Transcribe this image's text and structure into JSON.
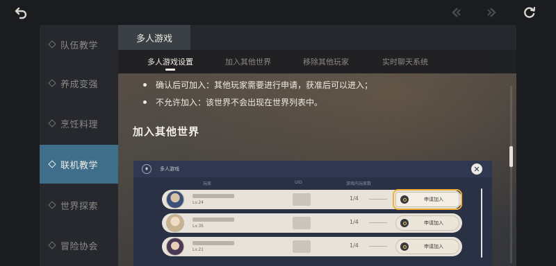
{
  "sidebar": {
    "items": [
      {
        "label": "队伍教学",
        "active": false
      },
      {
        "label": "养成变强",
        "active": false
      },
      {
        "label": "烹饪料理",
        "active": false
      },
      {
        "label": "联机教学",
        "active": true
      },
      {
        "label": "世界探索",
        "active": false
      },
      {
        "label": "冒险协会",
        "active": false
      }
    ]
  },
  "panel": {
    "title": "多人游戏",
    "tabs": [
      {
        "label": "多人游戏设置",
        "active": true
      },
      {
        "label": "加入其他世界",
        "active": false
      },
      {
        "label": "移除其他玩家",
        "active": false
      },
      {
        "label": "实时聊天系统",
        "active": false
      }
    ],
    "bullets": [
      "确认后可加入：其他玩家需要进行申请，获准后可以进入；",
      "不允许加入：该世界不会出现在世界列表中。"
    ],
    "section_title": "加入其他世界"
  },
  "embed": {
    "title": "多人游戏",
    "columns": {
      "player": "玩家",
      "uid": "UID",
      "count": "游戏内玩家数"
    },
    "players": [
      {
        "level": "Lv.24",
        "count": "1/4",
        "join_label": "申请加入",
        "focused": true
      },
      {
        "level": "Lv.35",
        "count": "1/4",
        "join_label": "申请加入",
        "focused": false
      },
      {
        "level": "Lv.21",
        "count": "1/4",
        "join_label": "申请加入",
        "focused": false
      }
    ]
  },
  "colors": {
    "sidebar_active": "#3f6e8a",
    "focus_outline": "#f1b23d",
    "background": "#1b1c20"
  },
  "icons": [
    "back-arrow-icon",
    "prev-icon",
    "next-icon",
    "refresh-icon",
    "close-icon"
  ]
}
